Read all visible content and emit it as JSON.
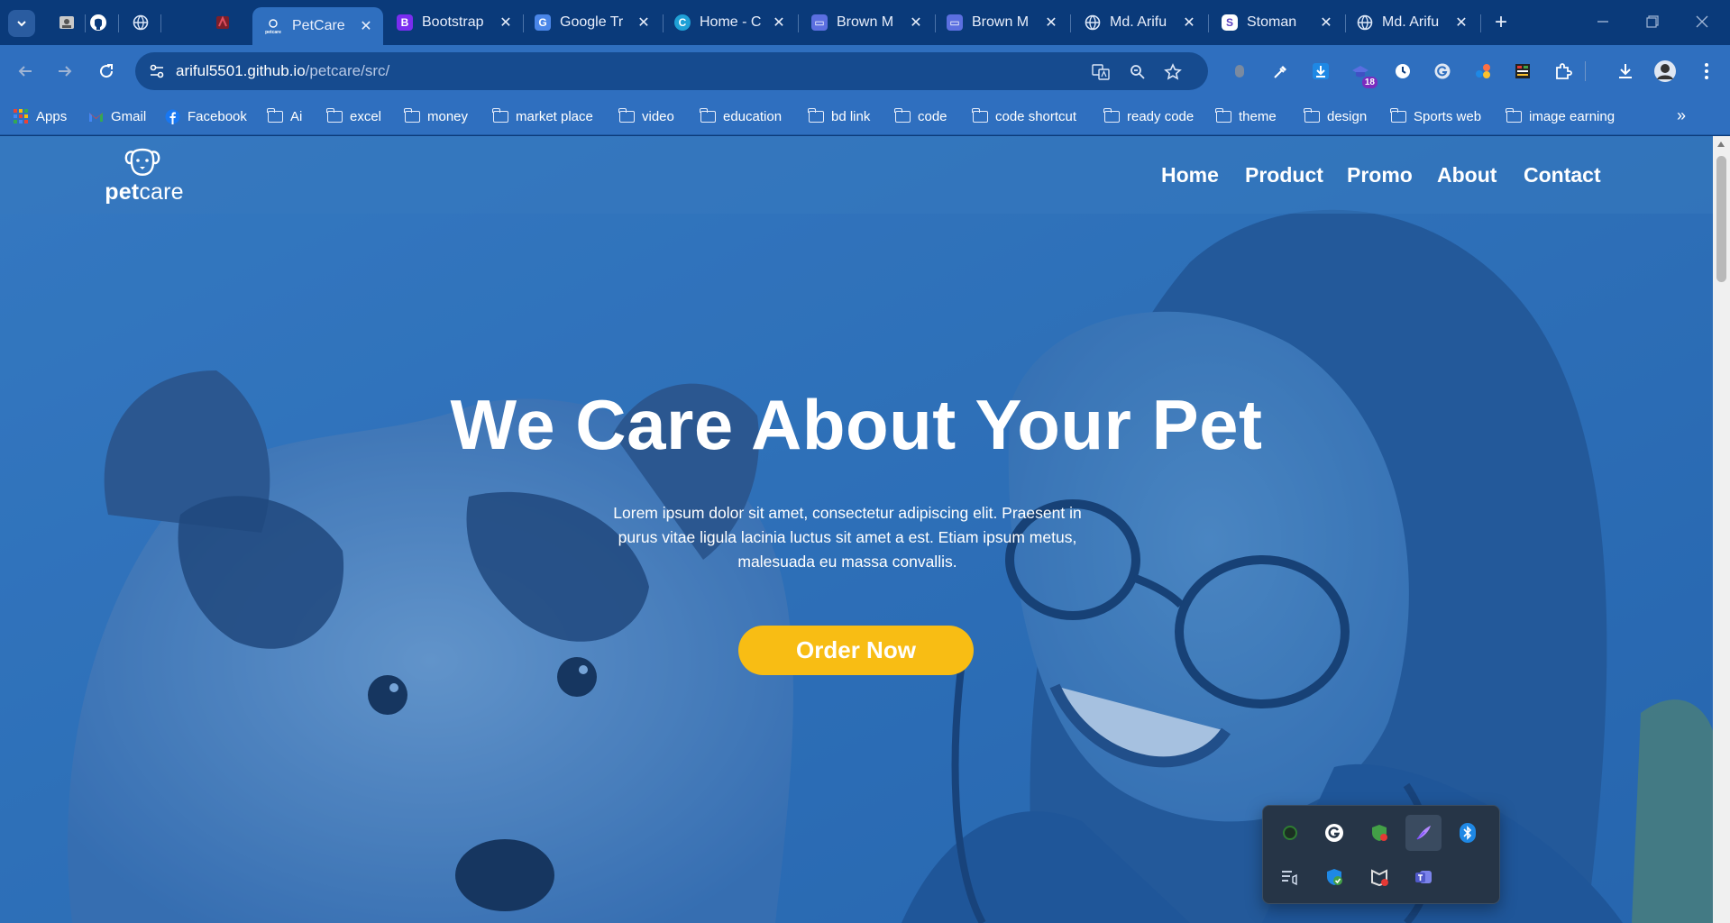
{
  "browser": {
    "tabs": [
      {
        "title": "PetCare",
        "active": true
      },
      {
        "title": "Bootstrap",
        "active": false
      },
      {
        "title": "Google Tr",
        "active": false
      },
      {
        "title": "Home - C",
        "active": false
      },
      {
        "title": "Brown M",
        "active": false
      },
      {
        "title": "Brown M",
        "active": false
      },
      {
        "title": "Md. Arifu",
        "active": false
      },
      {
        "title": "Stoman",
        "active": false
      },
      {
        "title": "Md. Arifu",
        "active": false
      }
    ],
    "favicon_letters": {
      "bootstrap": "B",
      "stoman": "S"
    },
    "url_host": "ariful5501.github.io",
    "url_path": "/petcare/src/",
    "extension_badge": "18",
    "bookmarks": [
      "Apps",
      "Gmail",
      "Facebook",
      "Ai",
      "excel",
      "money",
      "market place",
      "video",
      "education",
      "bd link",
      "code",
      "code shortcut",
      "ready code",
      "theme",
      "design",
      "Sports web",
      "image earning"
    ],
    "favicon_logo_text": "petcare"
  },
  "site": {
    "logo": {
      "bold": "pet",
      "light": "care"
    },
    "nav": [
      "Home",
      "Product",
      "Promo",
      "About",
      "Contact"
    ],
    "hero": {
      "title": "We Care About Your Pet",
      "text": "Lorem ipsum dolor sit amet, consectetur adipiscing elit. Praesent in purus vitae ligula lacinia luctus sit amet a est. Etiam ipsum metus, malesuada eu massa convallis.",
      "button": "Order Now"
    }
  },
  "colors": {
    "chrome_dark": "#0a3a7a",
    "chrome": "#2f6fbf",
    "hero_overlay": "#2a6cb4",
    "accent_button": "#f8bd14"
  }
}
